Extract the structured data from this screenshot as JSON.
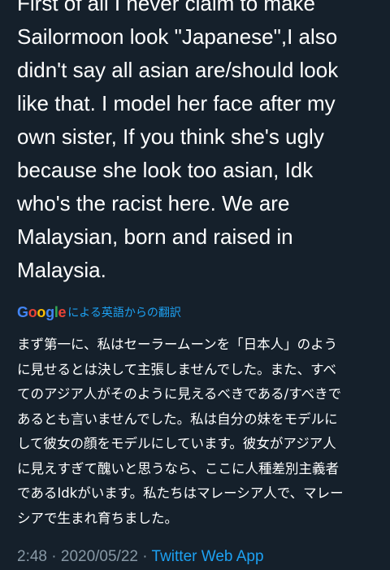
{
  "tweet": {
    "text_lines": [
      "First of all I never claim to make",
      "Sailormoon look \"Japanese\",I also",
      "didn't say all asian are/should look",
      "like that. I model her face after my",
      "own sister, If you think she's ugly",
      "because she look too asian, Idk",
      "who's the racist here. We are",
      "Malaysian, born and raised in",
      "Malaysia."
    ],
    "translation_attribution": {
      "brand_letters": [
        "G",
        "o",
        "o",
        "g",
        "l",
        "e"
      ],
      "label": "による英語からの翻訳"
    },
    "translation_lines": [
      "まず第一に、私はセーラームーンを「日本人」のよう",
      "に見せるとは決して主張しませんでした。また、すべ",
      "てのアジア人がそのように見えるべきである/すべきで",
      "あるとも言いませんでした。私は自分の妹をモデルに",
      "して彼女の顔をモデルにしています。彼女がアジア人",
      "に見えすぎて醜いと思うなら、ここに人種差別主義者",
      "であるIdkがいます。私たちはマレーシア人で、マレー",
      "シアで生まれ育ちました。"
    ],
    "meta": {
      "time": "2:48",
      "separator": "·",
      "date": "2020/05/22",
      "source": "Twitter Web App"
    }
  },
  "colors": {
    "background": "#15202b",
    "text": "#ffffff",
    "secondary_text": "#8899a6",
    "link": "#1da1f2"
  }
}
